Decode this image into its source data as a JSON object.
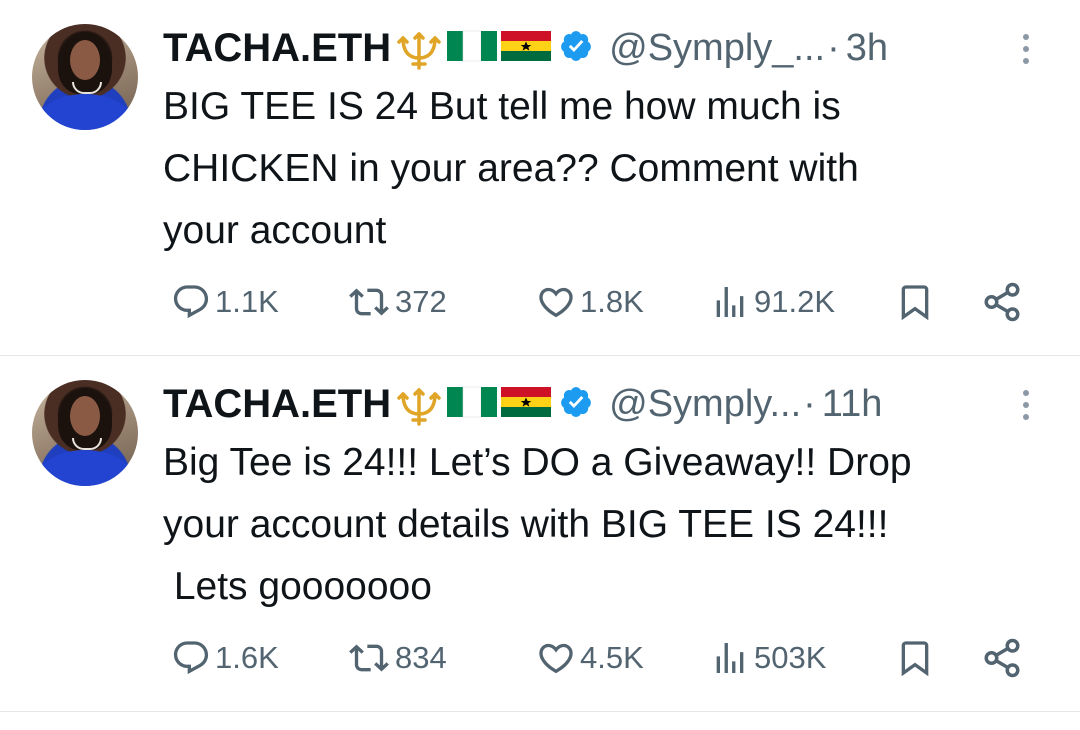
{
  "tweets": [
    {
      "name": "TACHA.ETH",
      "handle": "@Symply_...",
      "separator": "·",
      "time": "3h",
      "text": "BIG TEE IS 24 But tell me how much is\nCHICKEN in your area?? Comment with\nyour account",
      "replies": "1.1K",
      "retweets": "372",
      "likes": "1.8K",
      "views": "91.2K"
    },
    {
      "name": "TACHA.ETH",
      "handle": "@Symply...",
      "separator": "·",
      "time": "11h",
      "text": "Big Tee is 24!!! Let’s DO a Giveaway!! Drop\nyour account details with BIG TEE IS 24!!!\n Lets gooooooo",
      "replies": "1.6K",
      "retweets": "834",
      "likes": "4.5K",
      "views": "503K"
    }
  ],
  "icons": {
    "name_emojis": [
      "trident-emoji",
      "nigeria-flag",
      "ghana-flag"
    ],
    "verified": "verified-badge-icon",
    "more": "more-vertical-icon",
    "actions": [
      "reply-icon",
      "retweet-icon",
      "like-icon",
      "views-icon",
      "bookmark-icon",
      "share-icon"
    ]
  },
  "colors": {
    "text": "#0f1419",
    "secondary": "#536471",
    "verified": "#1d9bf0",
    "divider": "#e3e7ea",
    "trident": "#e0a526",
    "nigeria_green": "#008751",
    "ghana_red": "#ce1126",
    "ghana_gold": "#fcd116",
    "ghana_green": "#006b3f"
  }
}
